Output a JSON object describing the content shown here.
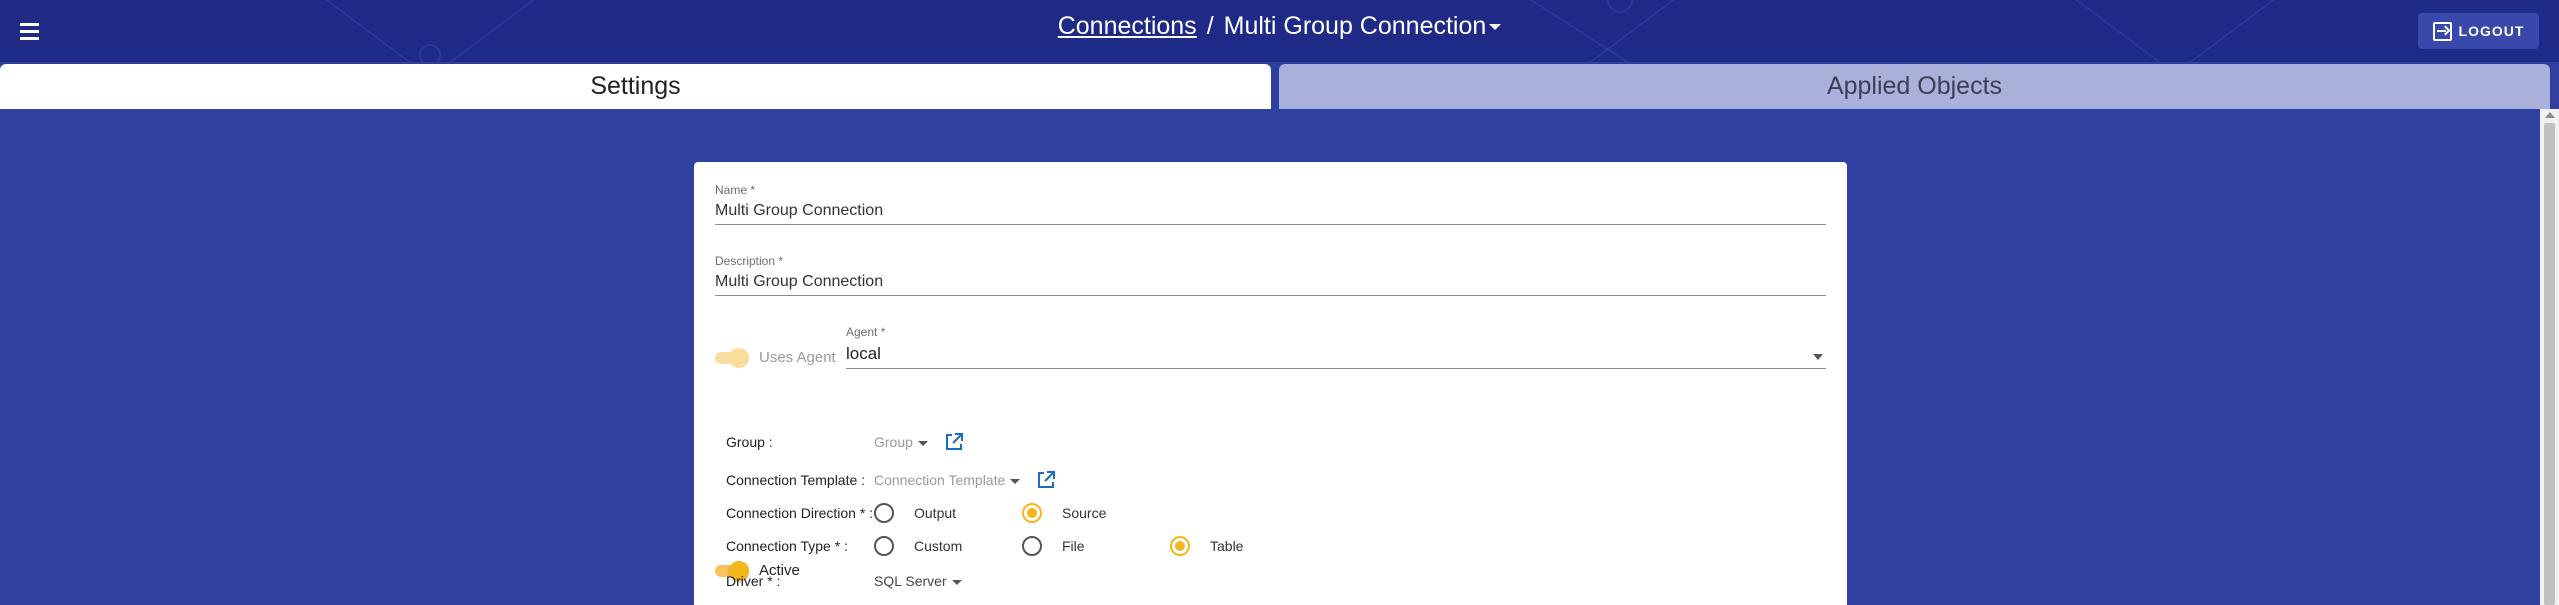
{
  "header": {
    "breadcrumb_link": "Connections",
    "separator": "/",
    "current": "Multi Group Connection",
    "logout_label": "LOGOUT"
  },
  "tabs": [
    {
      "label": "Settings",
      "active": true
    },
    {
      "label": "Applied Objects",
      "active": false
    }
  ],
  "form": {
    "name": {
      "label": "Name *",
      "value": "Multi Group Connection"
    },
    "description": {
      "label": "Description *",
      "value": "Multi Group Connection"
    },
    "uses_agent": {
      "label": "Uses Agent",
      "checked": true,
      "disabled": true
    },
    "agent": {
      "label": "Agent *",
      "value": "local"
    },
    "active": {
      "label": "Active",
      "checked": true
    },
    "group": {
      "label": "Group :",
      "placeholder": "Group"
    },
    "connection_template": {
      "label": "Connection Template :",
      "placeholder": "Connection Template"
    },
    "connection_direction": {
      "label": "Connection Direction * :",
      "options": [
        {
          "label": "Output",
          "selected": false
        },
        {
          "label": "Source",
          "selected": true
        }
      ]
    },
    "connection_type": {
      "label": "Connection Type * :",
      "options": [
        {
          "label": "Custom",
          "selected": false
        },
        {
          "label": "File",
          "selected": false
        },
        {
          "label": "Table",
          "selected": true
        }
      ]
    },
    "driver": {
      "label": "Driver * :",
      "value": "SQL Server"
    }
  },
  "colors": {
    "header_bg": "#1f2a87",
    "page_bg": "#2e3f9e",
    "accent": "#f5b61c",
    "link_icon": "#1a6fc4"
  },
  "icons": {
    "menu": "hamburger-icon",
    "logout": "logout-icon",
    "open_in_new": "open-in-new-icon"
  }
}
